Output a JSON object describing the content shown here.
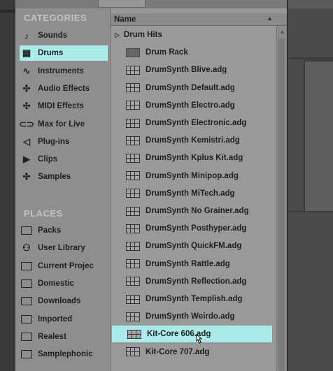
{
  "sidebar": {
    "categories_title": "CATEGORIES",
    "categories": [
      {
        "label": "Sounds",
        "icon": "note-icon",
        "glyph": "♪"
      },
      {
        "label": "Drums",
        "icon": "drums-grid-icon",
        "glyph": "▦",
        "selected": true
      },
      {
        "label": "Instruments",
        "icon": "waveform-icon",
        "glyph": "∿"
      },
      {
        "label": "Audio Effects",
        "icon": "audio-fx-icon",
        "glyph": "✣"
      },
      {
        "label": "MIDI Effects",
        "icon": "midi-fx-icon",
        "glyph": "✣"
      },
      {
        "label": "Max for Live",
        "icon": "max-icon",
        "glyph": "⊂⊃"
      },
      {
        "label": "Plug-ins",
        "icon": "plugin-icon",
        "glyph": "◁"
      },
      {
        "label": "Clips",
        "icon": "clip-icon",
        "glyph": "▶"
      },
      {
        "label": "Samples",
        "icon": "sample-icon",
        "glyph": "✣"
      }
    ],
    "places_title": "PLACES",
    "places": [
      {
        "label": "Packs",
        "icon": "folder-icon"
      },
      {
        "label": "User Library",
        "icon": "user-icon"
      },
      {
        "label": "Current Projec",
        "icon": "folder-icon"
      },
      {
        "label": "Domestic",
        "icon": "folder-icon"
      },
      {
        "label": "Downloads",
        "icon": "folder-icon"
      },
      {
        "label": "Imported",
        "icon": "folder-icon"
      },
      {
        "label": "Realest",
        "icon": "folder-icon"
      },
      {
        "label": "Samplephonic",
        "icon": "folder-icon"
      }
    ]
  },
  "filelist": {
    "column_name": "Name",
    "items": [
      {
        "label": "Drum Hits",
        "type": "folder"
      },
      {
        "label": "Drum Rack",
        "type": "rack"
      },
      {
        "label": "DrumSynth Blive.adg",
        "type": "preset"
      },
      {
        "label": "DrumSynth Default.adg",
        "type": "preset"
      },
      {
        "label": "DrumSynth Electro.adg",
        "type": "preset"
      },
      {
        "label": "DrumSynth Electronic.adg",
        "type": "preset"
      },
      {
        "label": "DrumSynth Kemistri.adg",
        "type": "preset"
      },
      {
        "label": "DrumSynth Kplus Kit.adg",
        "type": "preset"
      },
      {
        "label": "DrumSynth Minipop.adg",
        "type": "preset"
      },
      {
        "label": "DrumSynth MiTech.adg",
        "type": "preset"
      },
      {
        "label": "DrumSynth No Grainer.adg",
        "type": "preset"
      },
      {
        "label": "DrumSynth Posthyper.adg",
        "type": "preset"
      },
      {
        "label": "DrumSynth QuickFM.adg",
        "type": "preset"
      },
      {
        "label": "DrumSynth Rattle.adg",
        "type": "preset"
      },
      {
        "label": "DrumSynth Reflection.adg",
        "type": "preset"
      },
      {
        "label": "DrumSynth Templish.adg",
        "type": "preset"
      },
      {
        "label": "DrumSynth Weirdo.adg",
        "type": "preset"
      },
      {
        "label": "Kit-Core 606.adg",
        "type": "preset",
        "selected": true
      },
      {
        "label": "Kit-Core 707.adg",
        "type": "preset"
      }
    ]
  },
  "colors": {
    "selection": "#a9ecea",
    "browser_bg": "#999999",
    "sidebar_bg": "#8e8e8e"
  }
}
